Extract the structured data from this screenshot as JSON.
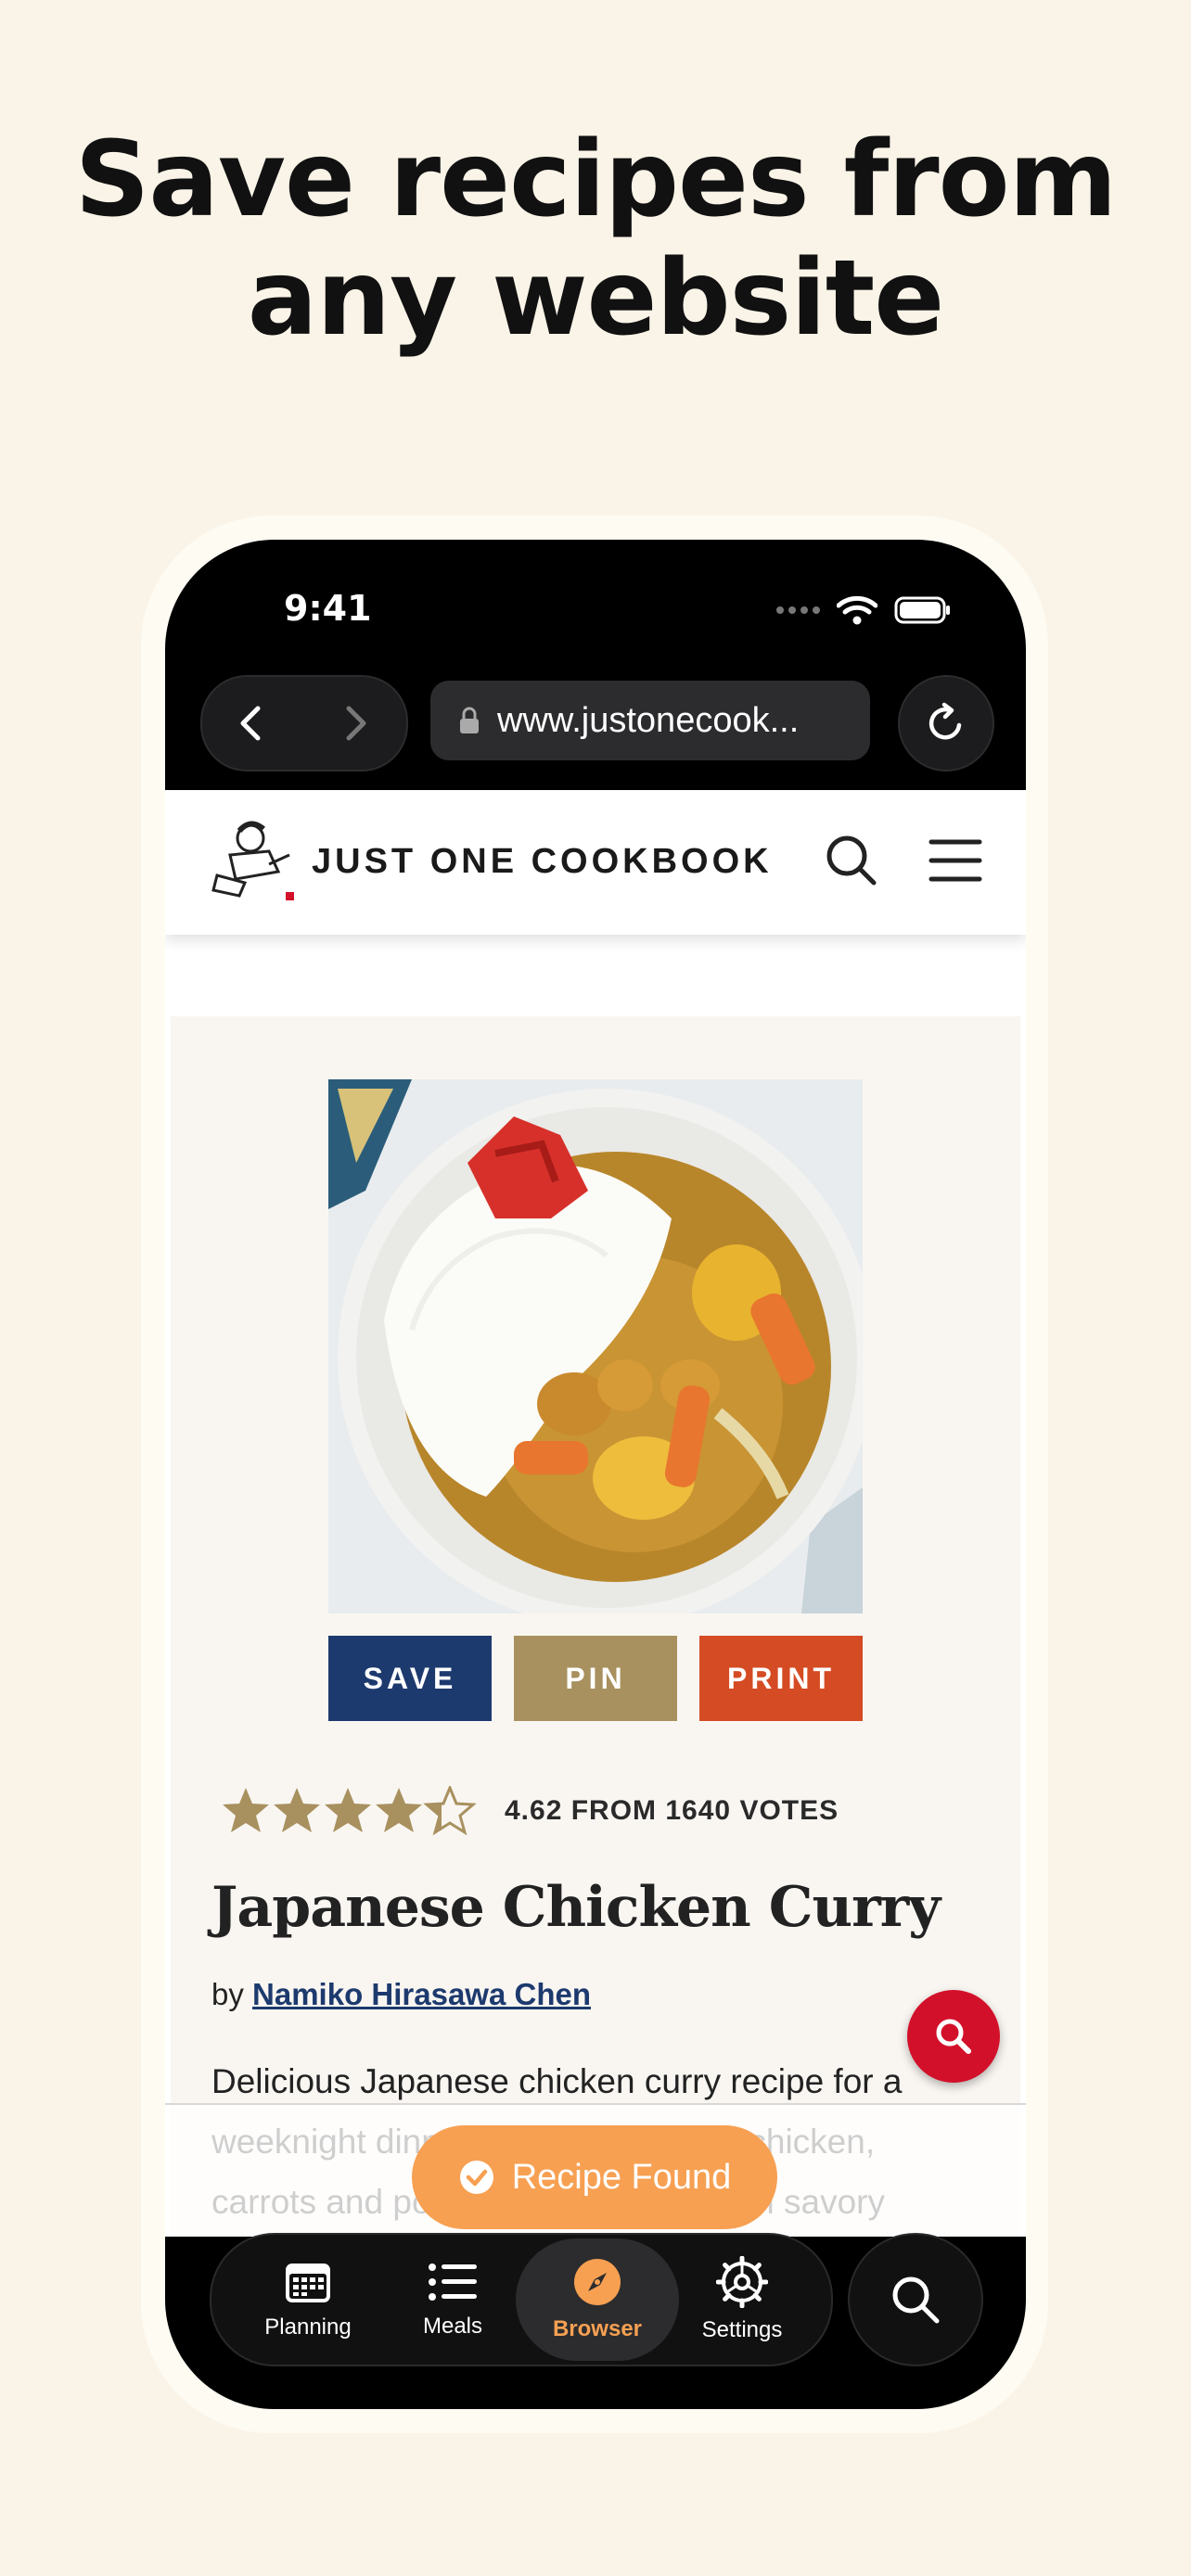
{
  "headline": {
    "line1": "Save recipes from",
    "line2": "any website"
  },
  "status": {
    "time": "9:41"
  },
  "browser": {
    "url": "www.justonecook..."
  },
  "site": {
    "brand": "JUST ONE COOKBOOK",
    "buttons": {
      "save": "SAVE",
      "pin": "PIN",
      "print": "PRINT"
    },
    "rating": {
      "value": 4.62,
      "max": 5,
      "text": "4.62 FROM 1640 VOTES"
    },
    "title": "Japanese Chicken Curry",
    "byline": {
      "prefix": "by",
      "author": "Namiko Hirasawa Chen"
    },
    "description": "Delicious Japanese chicken curry recipe for a weeknight dinner. Tender pieces of chicken, carrots and potatoes cooked in a rich savory"
  },
  "toast": {
    "label": "Recipe Found"
  },
  "tabs": [
    {
      "label": "Planning",
      "icon": "calendar-icon"
    },
    {
      "label": "Meals",
      "icon": "list-icon"
    },
    {
      "label": "Browser",
      "icon": "compass-icon"
    },
    {
      "label": "Settings",
      "icon": "gear-icon"
    }
  ],
  "colors": {
    "background": "#faf4e8",
    "accent": "#f7a052",
    "save": "#1d3a6e",
    "pin": "#a8915f",
    "print": "#d44b24",
    "fab": "#d3102a",
    "star": "#a8915f"
  }
}
